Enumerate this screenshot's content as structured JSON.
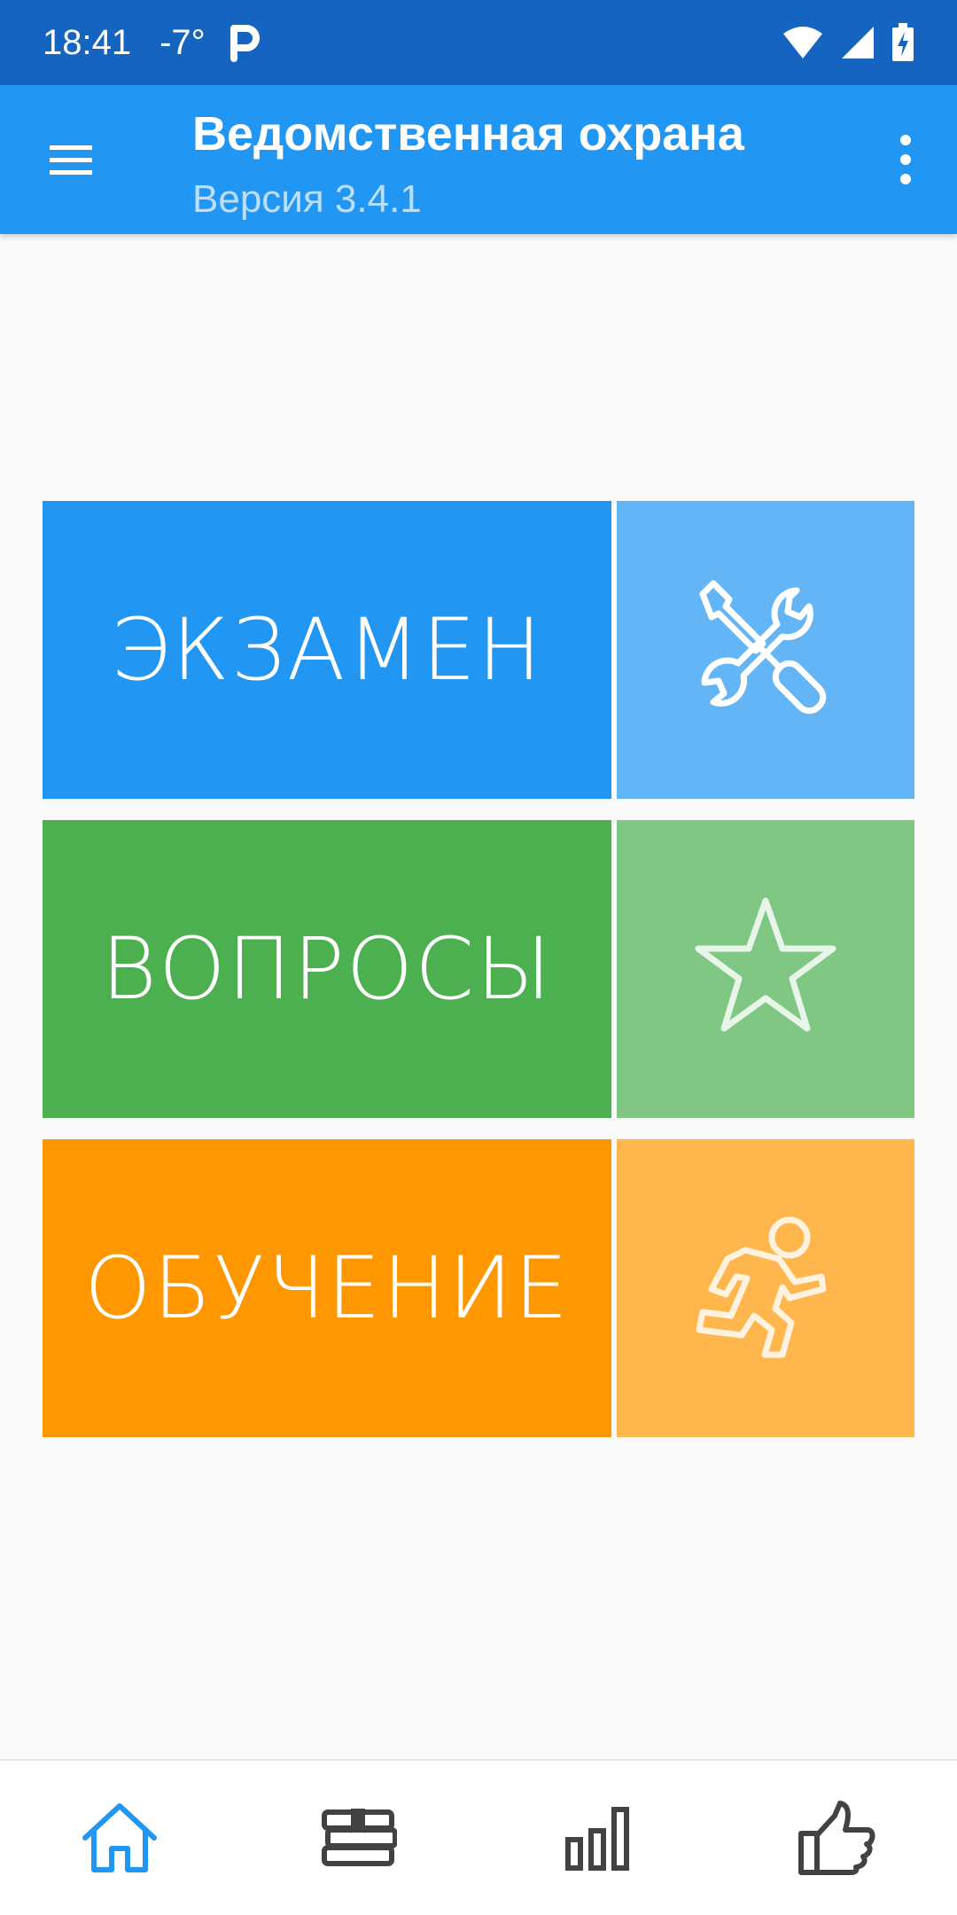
{
  "status_bar": {
    "time": "18:41",
    "temperature": "-7°",
    "notification_icon": "parking-p-icon",
    "icons": [
      "wifi-icon",
      "signal-icon",
      "battery-charging-icon"
    ]
  },
  "app_bar": {
    "title": "Ведомственная охрана",
    "subtitle": "Версия 3.4.1",
    "menu_icon": "hamburger-menu-icon",
    "more_icon": "more-vert-icon"
  },
  "tiles": [
    {
      "label": "ЭКЗАМЕН",
      "color": "#2196f3",
      "icon": "tools-icon",
      "icon_bg": "#64b5f6"
    },
    {
      "label": "ВОПРОСЫ",
      "color": "#4caf50",
      "icon": "star-icon",
      "icon_bg": "#81c784"
    },
    {
      "label": "ОБУЧЕНИЕ",
      "color": "#ff9800",
      "icon": "running-person-icon",
      "icon_bg": "#ffb74d"
    }
  ],
  "bottom_nav": {
    "items": [
      {
        "icon": "home-icon",
        "active": true
      },
      {
        "icon": "books-bookmark-icon",
        "active": false
      },
      {
        "icon": "bar-chart-icon",
        "active": false
      },
      {
        "icon": "thumbs-up-icon",
        "active": false
      }
    ],
    "active_color": "#2196f3",
    "inactive_color": "#424242"
  }
}
